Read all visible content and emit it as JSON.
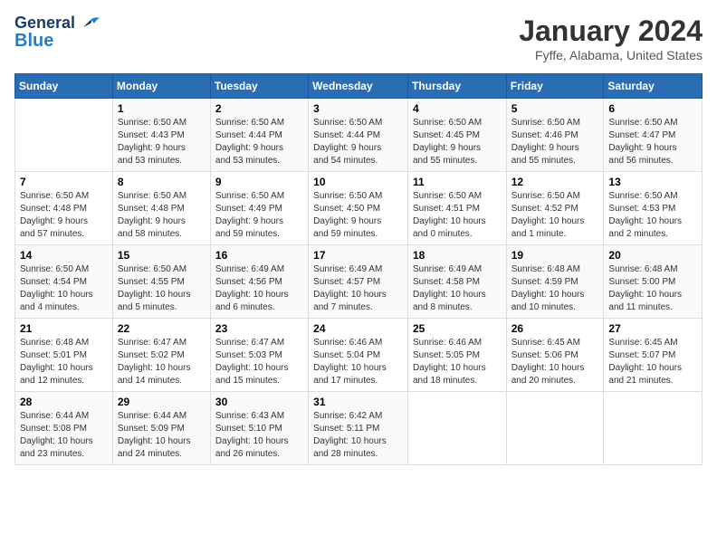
{
  "header": {
    "logo_line1": "General",
    "logo_line2": "Blue",
    "month_title": "January 2024",
    "location": "Fyffe, Alabama, United States"
  },
  "days_of_week": [
    "Sunday",
    "Monday",
    "Tuesday",
    "Wednesday",
    "Thursday",
    "Friday",
    "Saturday"
  ],
  "weeks": [
    [
      {
        "day": "",
        "info": ""
      },
      {
        "day": "1",
        "info": "Sunrise: 6:50 AM\nSunset: 4:43 PM\nDaylight: 9 hours\nand 53 minutes."
      },
      {
        "day": "2",
        "info": "Sunrise: 6:50 AM\nSunset: 4:44 PM\nDaylight: 9 hours\nand 53 minutes."
      },
      {
        "day": "3",
        "info": "Sunrise: 6:50 AM\nSunset: 4:44 PM\nDaylight: 9 hours\nand 54 minutes."
      },
      {
        "day": "4",
        "info": "Sunrise: 6:50 AM\nSunset: 4:45 PM\nDaylight: 9 hours\nand 55 minutes."
      },
      {
        "day": "5",
        "info": "Sunrise: 6:50 AM\nSunset: 4:46 PM\nDaylight: 9 hours\nand 55 minutes."
      },
      {
        "day": "6",
        "info": "Sunrise: 6:50 AM\nSunset: 4:47 PM\nDaylight: 9 hours\nand 56 minutes."
      }
    ],
    [
      {
        "day": "7",
        "info": "Sunrise: 6:50 AM\nSunset: 4:48 PM\nDaylight: 9 hours\nand 57 minutes."
      },
      {
        "day": "8",
        "info": "Sunrise: 6:50 AM\nSunset: 4:48 PM\nDaylight: 9 hours\nand 58 minutes."
      },
      {
        "day": "9",
        "info": "Sunrise: 6:50 AM\nSunset: 4:49 PM\nDaylight: 9 hours\nand 59 minutes."
      },
      {
        "day": "10",
        "info": "Sunrise: 6:50 AM\nSunset: 4:50 PM\nDaylight: 9 hours\nand 59 minutes."
      },
      {
        "day": "11",
        "info": "Sunrise: 6:50 AM\nSunset: 4:51 PM\nDaylight: 10 hours\nand 0 minutes."
      },
      {
        "day": "12",
        "info": "Sunrise: 6:50 AM\nSunset: 4:52 PM\nDaylight: 10 hours\nand 1 minute."
      },
      {
        "day": "13",
        "info": "Sunrise: 6:50 AM\nSunset: 4:53 PM\nDaylight: 10 hours\nand 2 minutes."
      }
    ],
    [
      {
        "day": "14",
        "info": "Sunrise: 6:50 AM\nSunset: 4:54 PM\nDaylight: 10 hours\nand 4 minutes."
      },
      {
        "day": "15",
        "info": "Sunrise: 6:50 AM\nSunset: 4:55 PM\nDaylight: 10 hours\nand 5 minutes."
      },
      {
        "day": "16",
        "info": "Sunrise: 6:49 AM\nSunset: 4:56 PM\nDaylight: 10 hours\nand 6 minutes."
      },
      {
        "day": "17",
        "info": "Sunrise: 6:49 AM\nSunset: 4:57 PM\nDaylight: 10 hours\nand 7 minutes."
      },
      {
        "day": "18",
        "info": "Sunrise: 6:49 AM\nSunset: 4:58 PM\nDaylight: 10 hours\nand 8 minutes."
      },
      {
        "day": "19",
        "info": "Sunrise: 6:48 AM\nSunset: 4:59 PM\nDaylight: 10 hours\nand 10 minutes."
      },
      {
        "day": "20",
        "info": "Sunrise: 6:48 AM\nSunset: 5:00 PM\nDaylight: 10 hours\nand 11 minutes."
      }
    ],
    [
      {
        "day": "21",
        "info": "Sunrise: 6:48 AM\nSunset: 5:01 PM\nDaylight: 10 hours\nand 12 minutes."
      },
      {
        "day": "22",
        "info": "Sunrise: 6:47 AM\nSunset: 5:02 PM\nDaylight: 10 hours\nand 14 minutes."
      },
      {
        "day": "23",
        "info": "Sunrise: 6:47 AM\nSunset: 5:03 PM\nDaylight: 10 hours\nand 15 minutes."
      },
      {
        "day": "24",
        "info": "Sunrise: 6:46 AM\nSunset: 5:04 PM\nDaylight: 10 hours\nand 17 minutes."
      },
      {
        "day": "25",
        "info": "Sunrise: 6:46 AM\nSunset: 5:05 PM\nDaylight: 10 hours\nand 18 minutes."
      },
      {
        "day": "26",
        "info": "Sunrise: 6:45 AM\nSunset: 5:06 PM\nDaylight: 10 hours\nand 20 minutes."
      },
      {
        "day": "27",
        "info": "Sunrise: 6:45 AM\nSunset: 5:07 PM\nDaylight: 10 hours\nand 21 minutes."
      }
    ],
    [
      {
        "day": "28",
        "info": "Sunrise: 6:44 AM\nSunset: 5:08 PM\nDaylight: 10 hours\nand 23 minutes."
      },
      {
        "day": "29",
        "info": "Sunrise: 6:44 AM\nSunset: 5:09 PM\nDaylight: 10 hours\nand 24 minutes."
      },
      {
        "day": "30",
        "info": "Sunrise: 6:43 AM\nSunset: 5:10 PM\nDaylight: 10 hours\nand 26 minutes."
      },
      {
        "day": "31",
        "info": "Sunrise: 6:42 AM\nSunset: 5:11 PM\nDaylight: 10 hours\nand 28 minutes."
      },
      {
        "day": "",
        "info": ""
      },
      {
        "day": "",
        "info": ""
      },
      {
        "day": "",
        "info": ""
      }
    ]
  ]
}
